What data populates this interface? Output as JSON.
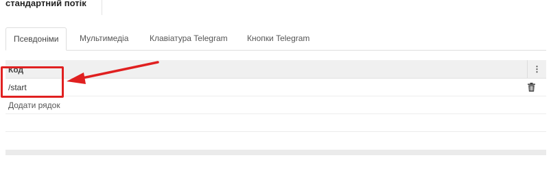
{
  "header": {
    "flow_title": "стандартний потік"
  },
  "tabs": [
    {
      "label": "Псевдоніми",
      "active": true
    },
    {
      "label": "Мультимедіа",
      "active": false
    },
    {
      "label": "Клавіатура Telegram",
      "active": false
    },
    {
      "label": "Кнопки Telegram",
      "active": false
    }
  ],
  "grid": {
    "columns": [
      {
        "label": "Код"
      }
    ],
    "column_menu_icon": "vertical-dots-icon",
    "rows": [
      {
        "code": "/start",
        "action_icon": "trash-icon"
      }
    ],
    "add_row_label": "Додати рядок"
  },
  "annotation": {
    "color": "#e02020",
    "icons": [
      "highlight-box",
      "arrow-icon"
    ]
  },
  "colors": {
    "header_bg": "#f0f0f0",
    "border": "#dddddd",
    "annotation_red": "#e02020"
  }
}
